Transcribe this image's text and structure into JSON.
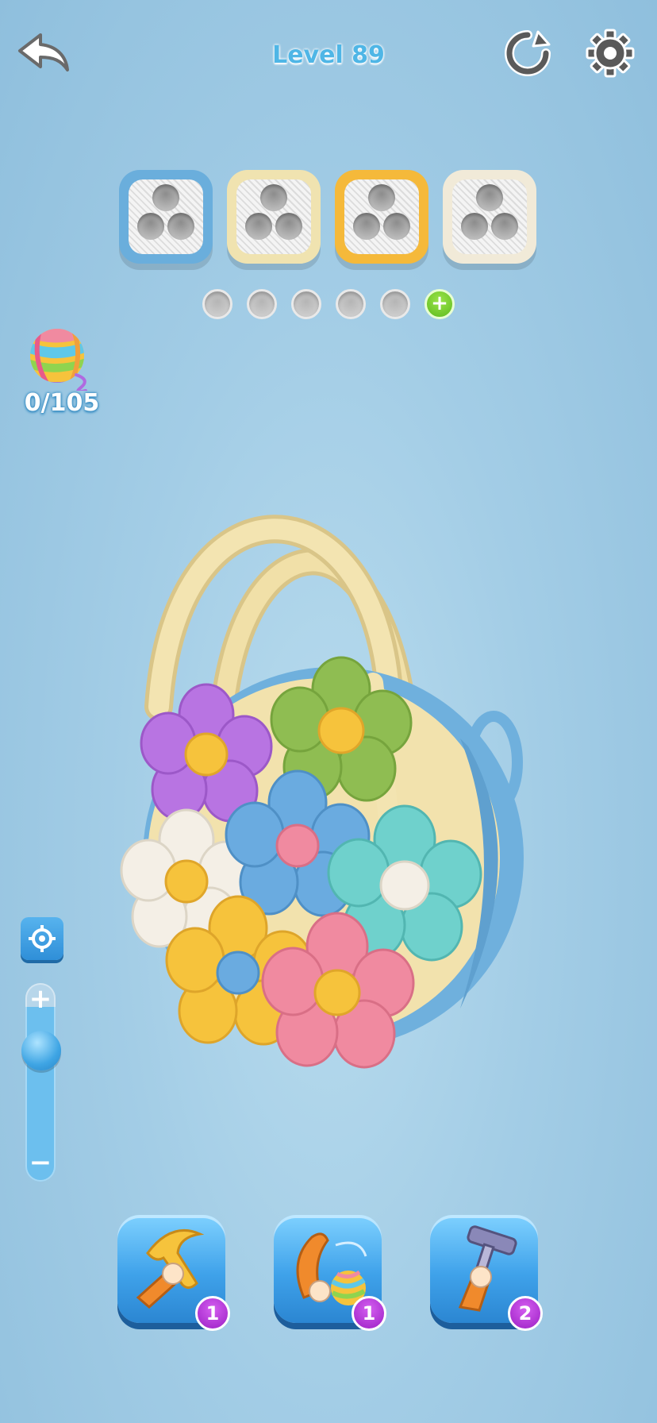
{
  "header": {
    "title": "Level 89",
    "back_icon": "back-arrow-icon",
    "restart_icon": "restart-icon",
    "settings_icon": "gear-icon"
  },
  "spools": [
    {
      "color": "#6aaedc"
    },
    {
      "color": "#f0e3b0"
    },
    {
      "color": "#f5b93a"
    },
    {
      "color": "#f1ead8"
    }
  ],
  "slots": {
    "empty_count": 5,
    "add_label": "+"
  },
  "yarn_counter": {
    "icon": "yarn-ball-icon",
    "text": "0/105"
  },
  "zoom": {
    "plus_label": "+",
    "minus_label": "−",
    "level": 0.25,
    "focus_icon": "target-icon"
  },
  "boosters": [
    {
      "name": "hammer",
      "icon": "hammer-hand-icon",
      "count": "1"
    },
    {
      "name": "magnet",
      "icon": "yarn-grab-icon",
      "count": "1"
    },
    {
      "name": "vacuum",
      "icon": "vacuum-hand-icon",
      "count": "2"
    }
  ],
  "colors": {
    "basket_blue": "#6fb0dd",
    "basket_cream": "#f2e2ad",
    "purple": "#b874e2",
    "green": "#8fbd52",
    "white": "#f4efe6",
    "blue": "#6aabe0",
    "teal": "#6fd1cc",
    "yellow": "#f6c33c",
    "pink": "#f08aa0"
  }
}
